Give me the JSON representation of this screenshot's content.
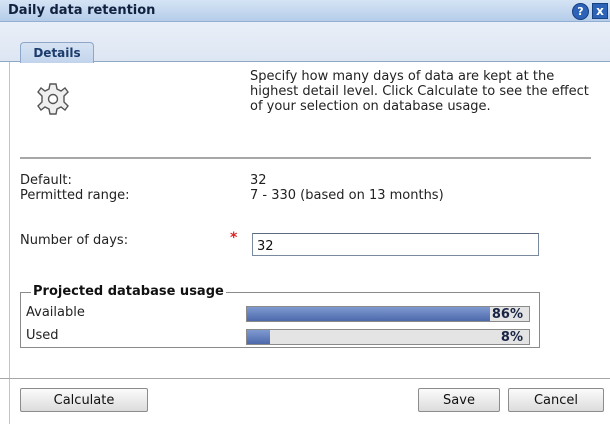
{
  "window": {
    "title": "Daily data retention",
    "help_glyph": "?",
    "close_glyph": "x"
  },
  "tabs": [
    {
      "label": "Details",
      "selected": true
    }
  ],
  "description": "Specify how many days of data are kept at the highest detail level. Click Calculate to see the effect of your selection on database usage.",
  "info": {
    "default_label": "Default:",
    "default_value": "32",
    "range_label": "Permitted range:",
    "range_value": "7 - 330 (based on 13 months)"
  },
  "days": {
    "label": "Number of days:",
    "required_mark": "*",
    "value": "32"
  },
  "usage": {
    "title": "Projected database usage",
    "rows": [
      {
        "label": "Available",
        "percent": 86,
        "percent_text": "86%"
      },
      {
        "label": "Used",
        "percent": 8,
        "percent_text": "8%"
      }
    ]
  },
  "buttons": {
    "calculate": "Calculate",
    "save": "Save",
    "cancel": "Cancel"
  },
  "icons": {
    "header": "gear-icon",
    "help": "help-icon",
    "close": "close-icon"
  },
  "colors": {
    "titlebar": "#c4d8f0",
    "bar_fill": "#5b77b8",
    "bar_track": "#e4e4e4",
    "required": "#dd2222"
  }
}
